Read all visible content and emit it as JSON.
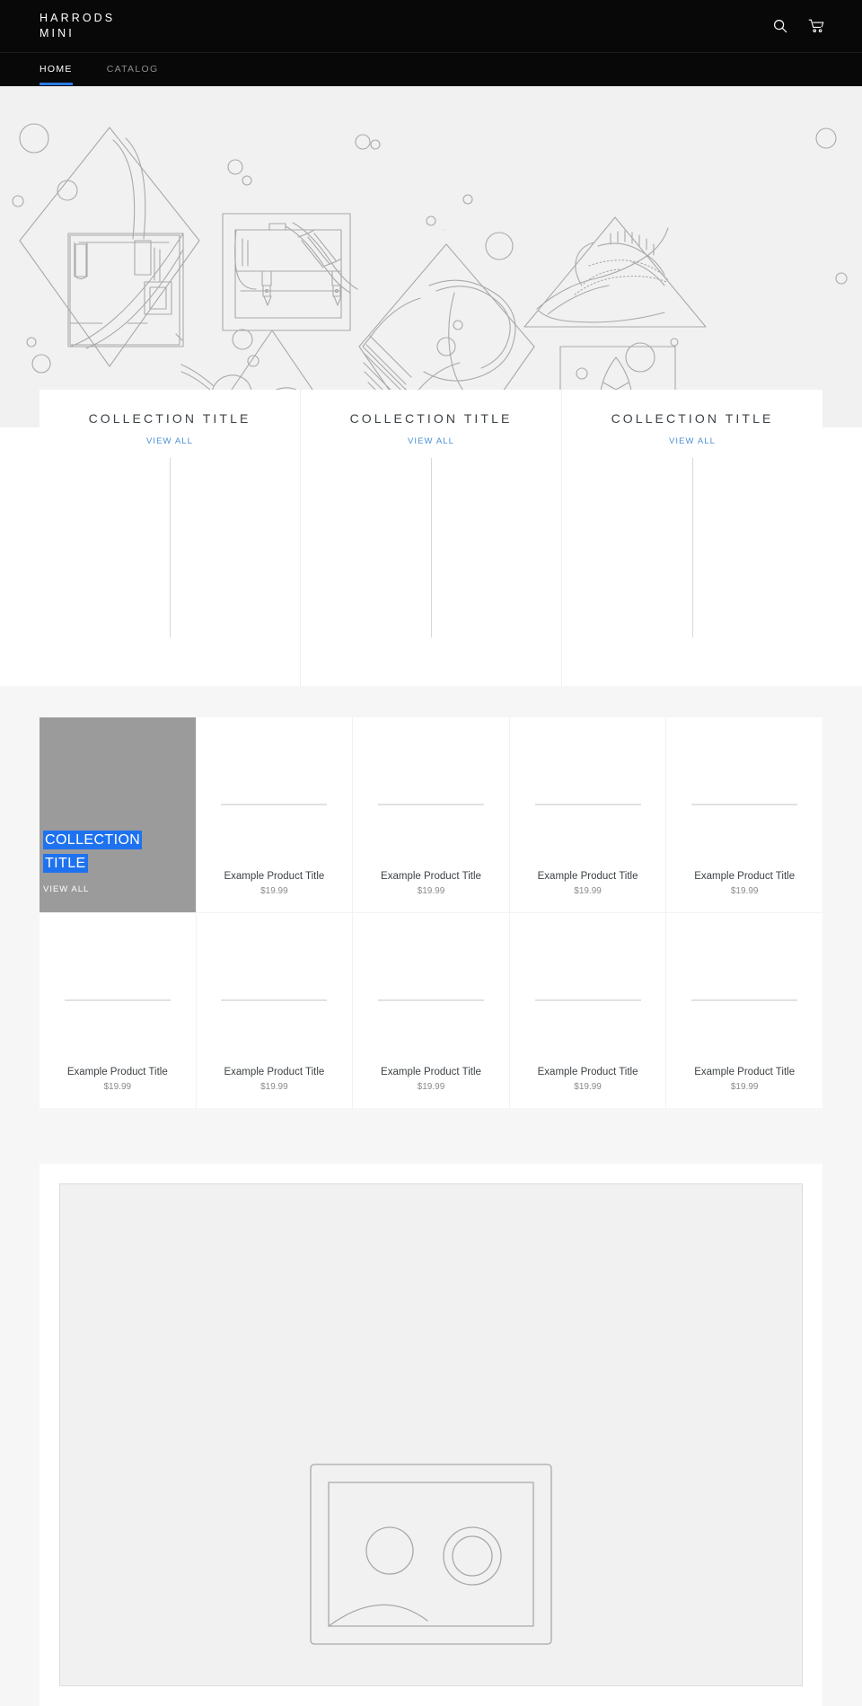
{
  "site": {
    "logo_line1": "HARRODS",
    "logo_line2": "MINI",
    "accent_blue": "#2a7ae4",
    "link_blue": "#4a90d9",
    "highlight_blue": "#1f72ef",
    "header_bg": "#080808",
    "hero_bg": "#f1f1f1",
    "tile_gray": "#9b9b9b"
  },
  "header": {
    "search_icon": "search-icon",
    "cart_icon": "cart-icon"
  },
  "nav": {
    "items": [
      {
        "label": "HOME",
        "active": true
      },
      {
        "label": "CATALOG",
        "active": false
      }
    ]
  },
  "hero": {
    "alt": "line-art illustration of handbags, shoes, glasses and feather in geometric frames"
  },
  "collections": [
    {
      "title": "COLLECTION TITLE",
      "link": "VIEW ALL"
    },
    {
      "title": "COLLECTION TITLE",
      "link": "VIEW ALL"
    },
    {
      "title": "COLLECTION TITLE",
      "link": "VIEW ALL"
    }
  ],
  "grid": {
    "tile": {
      "title_line1": "COLLECTION",
      "title_line2": "TITLE",
      "link": "VIEW ALL"
    },
    "row1": [
      {
        "title": "Example Product Title",
        "price": "$19.99"
      },
      {
        "title": "Example Product Title",
        "price": "$19.99"
      },
      {
        "title": "Example Product Title",
        "price": "$19.99"
      },
      {
        "title": "Example Product Title",
        "price": "$19.99"
      }
    ],
    "row2": [
      {
        "title": "Example Product Title",
        "price": "$19.99"
      },
      {
        "title": "Example Product Title",
        "price": "$19.99"
      },
      {
        "title": "Example Product Title",
        "price": "$19.99"
      },
      {
        "title": "Example Product Title",
        "price": "$19.99"
      },
      {
        "title": "Example Product Title",
        "price": "$19.99"
      }
    ]
  },
  "feature": {
    "alt": "line-art illustration placeholder"
  }
}
